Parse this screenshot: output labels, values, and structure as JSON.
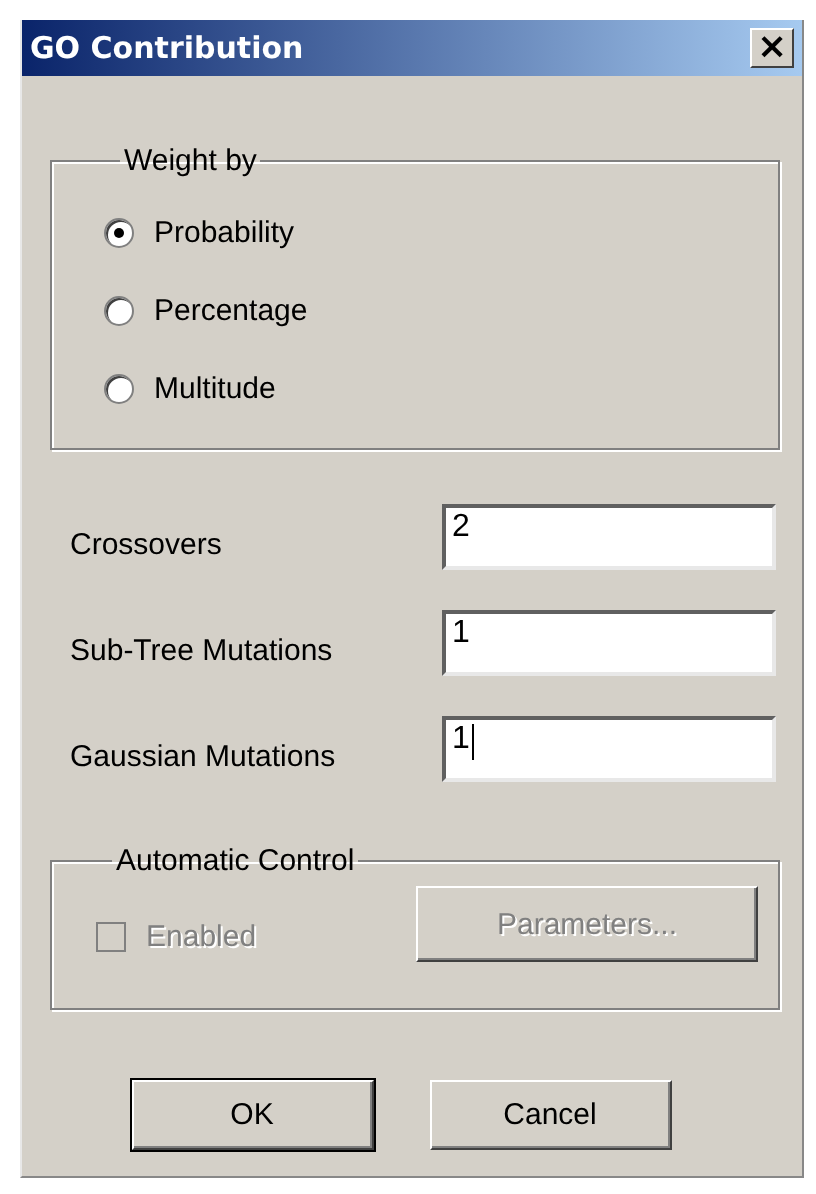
{
  "window": {
    "title": "GO Contribution",
    "close": "×"
  },
  "weight_by": {
    "title": "Weight by",
    "options": [
      {
        "label": "Probability",
        "selected": true
      },
      {
        "label": "Percentage",
        "selected": false
      },
      {
        "label": "Multitude",
        "selected": false
      }
    ]
  },
  "fields": [
    {
      "label": "Crossovers",
      "value": "2",
      "focused": false
    },
    {
      "label": "Sub-Tree Mutations",
      "value": "1",
      "focused": false
    },
    {
      "label": "Gaussian Mutations",
      "value": "1",
      "focused": true
    }
  ],
  "automatic_control": {
    "title": "Automatic Control",
    "enabled_checkbox": {
      "label": "Enabled",
      "checked": false,
      "disabled": true
    },
    "parameters_button": {
      "label": "Parameters...",
      "disabled": true
    }
  },
  "buttons": [
    {
      "label": "OK",
      "default": true
    },
    {
      "label": "Cancel",
      "default": false
    }
  ]
}
